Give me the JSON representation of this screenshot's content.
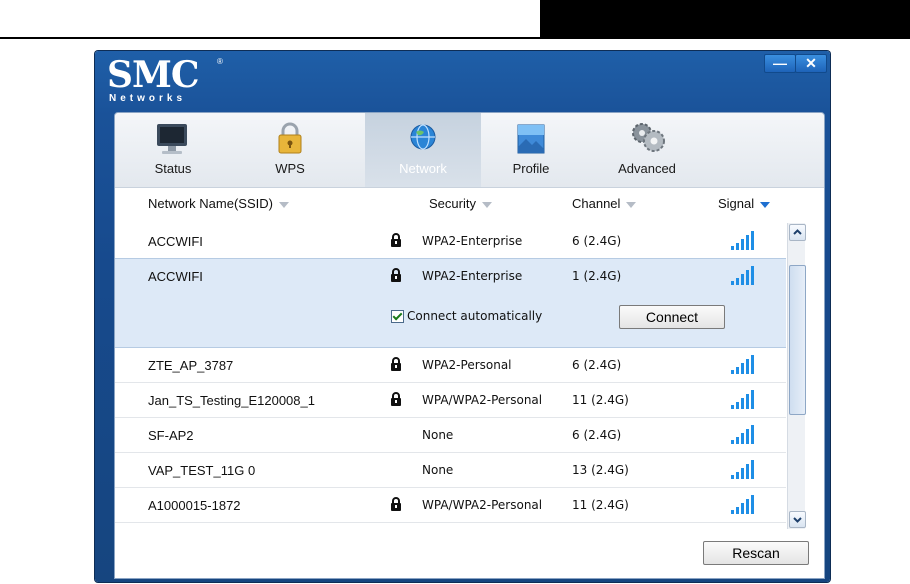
{
  "window": {
    "logo_main": "SMC",
    "logo_sub": "Networks",
    "logo_reg": "®",
    "minimize_glyph": "—",
    "close_glyph": "✕"
  },
  "tabs": [
    {
      "label": "Status",
      "icon": "monitor-icon",
      "active": false
    },
    {
      "label": "WPS",
      "icon": "padlock-icon",
      "active": false
    },
    {
      "label": "Network",
      "icon": "globe-icon",
      "active": true
    },
    {
      "label": "Profile",
      "icon": "profile-icon",
      "active": false
    },
    {
      "label": "Advanced",
      "icon": "gears-icon",
      "active": false
    }
  ],
  "table": {
    "headers": {
      "ssid": "Network Name(SSID)",
      "security": "Security",
      "channel": "Channel",
      "signal": "Signal"
    },
    "rows": [
      {
        "ssid": "ACCWIFI",
        "secured": true,
        "security": "WPA2-Enterprise",
        "channel": "6 (2.4G)",
        "selected": false
      },
      {
        "ssid": "ACCWIFI",
        "secured": true,
        "security": "WPA2-Enterprise",
        "channel": "1 (2.4G)",
        "selected": true
      },
      {
        "ssid": "ZTE_AP_3787",
        "secured": true,
        "security": "WPA2-Personal",
        "channel": "6 (2.4G)",
        "selected": false
      },
      {
        "ssid": "Jan_TS_Testing_E120008_1",
        "secured": true,
        "security": "WPA/WPA2-Personal",
        "channel": "11 (2.4G)",
        "selected": false
      },
      {
        "ssid": "SF-AP2",
        "secured": false,
        "security": "None",
        "channel": "6 (2.4G)",
        "selected": false
      },
      {
        "ssid": "VAP_TEST_11G 0",
        "secured": false,
        "security": "None",
        "channel": "13 (2.4G)",
        "selected": false
      },
      {
        "ssid": "A1000015-1872",
        "secured": true,
        "security": "WPA/WPA2-Personal",
        "channel": "11 (2.4G)",
        "selected": false
      }
    ]
  },
  "selected_detail": {
    "connect_auto_label": "Connect automatically",
    "connect_auto_checked": true,
    "connect_button": "Connect"
  },
  "rescan_button": "Rescan",
  "colors": {
    "window_blue": "#1a5299",
    "selection": "#dde9f7",
    "signal_blue": "#1e8ee6"
  }
}
